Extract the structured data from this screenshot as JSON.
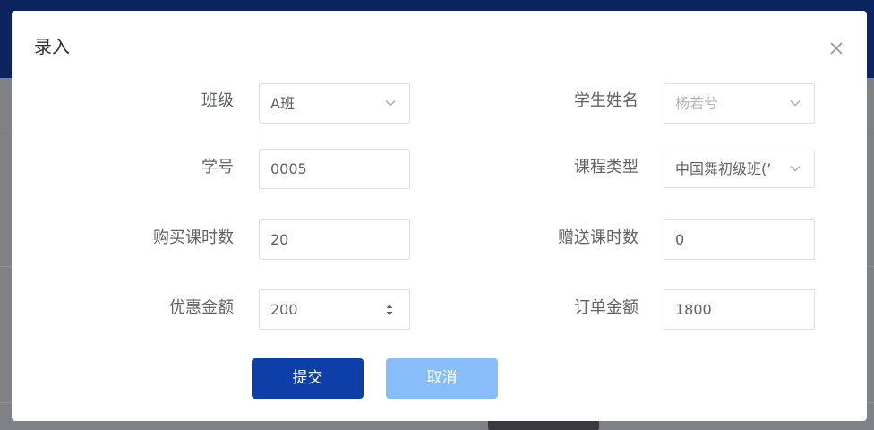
{
  "dialog": {
    "title": "录入"
  },
  "form": {
    "class": {
      "label": "班级",
      "value": "A班"
    },
    "student_name": {
      "label": "学生姓名",
      "value": "杨若兮"
    },
    "student_id": {
      "label": "学号",
      "value": "0005"
    },
    "course_type": {
      "label": "课程类型",
      "value": "中国舞初级班(’"
    },
    "purchased_hours": {
      "label": "购买课时数",
      "value": "20"
    },
    "gift_hours": {
      "label": "赠送课时数",
      "value": "0"
    },
    "discount_amount": {
      "label": "优惠金额",
      "value": "200"
    },
    "order_amount": {
      "label": "订单金额",
      "value": "1800"
    }
  },
  "buttons": {
    "submit": "提交",
    "cancel": "取消"
  },
  "colors": {
    "primary": "#0e3ea8",
    "cancel_light": "#87bdfa",
    "header_dark": "#0c2460"
  }
}
